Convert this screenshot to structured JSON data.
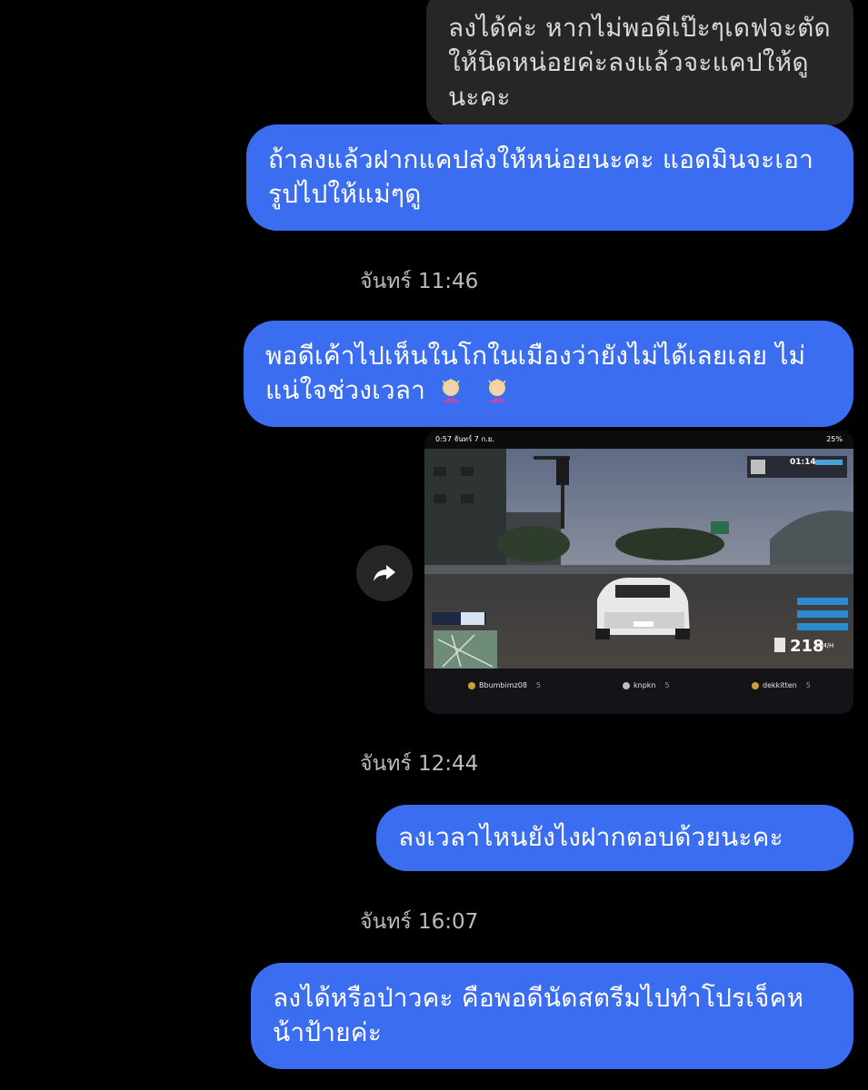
{
  "messages": {
    "m1": "ลงได้ค่ะ หากไม่พอดีเป๊ะๆเดฟจะตัดให้นิดหน่อยค่ะลงแล้วจะแคปให้ดูนะคะ",
    "m2": "ถ้าลงแล้วฝากแคปส่งให้หน่อยนะคะ แอดมินจะเอารูปไปให้แม่ๆดู",
    "m3": "พอดีเค้าไปเห็นในโกในเมืองว่ายังไม่ได้เลยเลย ไม่แน่ใจช่วงเวลา",
    "m4": "ลงเวลาไหนยังไงฝากตอบด้วยนะคะ",
    "m5": "ลงได้หรือป่าวคะ คือพอดีนัดสตรีมไปทำโปรเจ็คหน้าป้ายค่ะ"
  },
  "timestamps": {
    "t1": "จันทร์ 11:46",
    "t2": "จันทร์ 12:44",
    "t3": "จันทร์ 16:07"
  },
  "media": {
    "status_time": "0:57  จันทร์ 7 ก.ย.",
    "status_battery": "25%",
    "hud_timer": "01:14",
    "speed": "218",
    "speed_unit": "KM/H",
    "players": [
      {
        "name": "Bbumbimz08",
        "count": "5"
      },
      {
        "name": "knpkn",
        "count": "5"
      },
      {
        "name": "dekkitten",
        "count": "5"
      }
    ]
  },
  "icons": {
    "share": "share-arrow-icon",
    "emoji": "woman-bowing-emoji"
  },
  "colors": {
    "outgoing": "#3a6df0",
    "incoming": "#262626",
    "background": "#000000"
  }
}
